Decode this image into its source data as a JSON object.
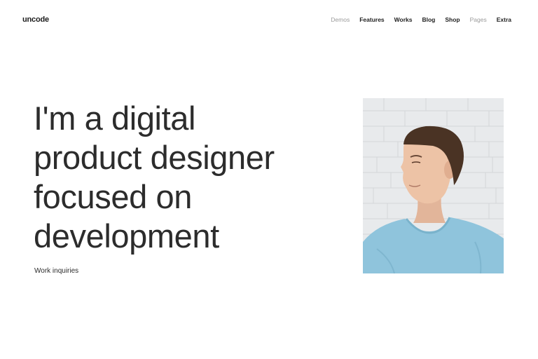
{
  "header": {
    "logo": "uncode",
    "nav": [
      {
        "label": "Demos",
        "muted": true
      },
      {
        "label": "Features",
        "muted": false
      },
      {
        "label": "Works",
        "muted": false
      },
      {
        "label": "Blog",
        "muted": false
      },
      {
        "label": "Shop",
        "muted": false
      },
      {
        "label": "Pages",
        "muted": true
      },
      {
        "label": "Extra",
        "muted": false
      }
    ]
  },
  "hero": {
    "headline_lines": [
      "I'm a digital",
      "product designer",
      "focused on",
      "development"
    ],
    "link": "Work inquiries"
  },
  "colors": {
    "text": "#2c2c2c",
    "muted_nav": "#9a9a9a",
    "shirt": "#8fc4dc",
    "wall": "#e9ebed"
  }
}
